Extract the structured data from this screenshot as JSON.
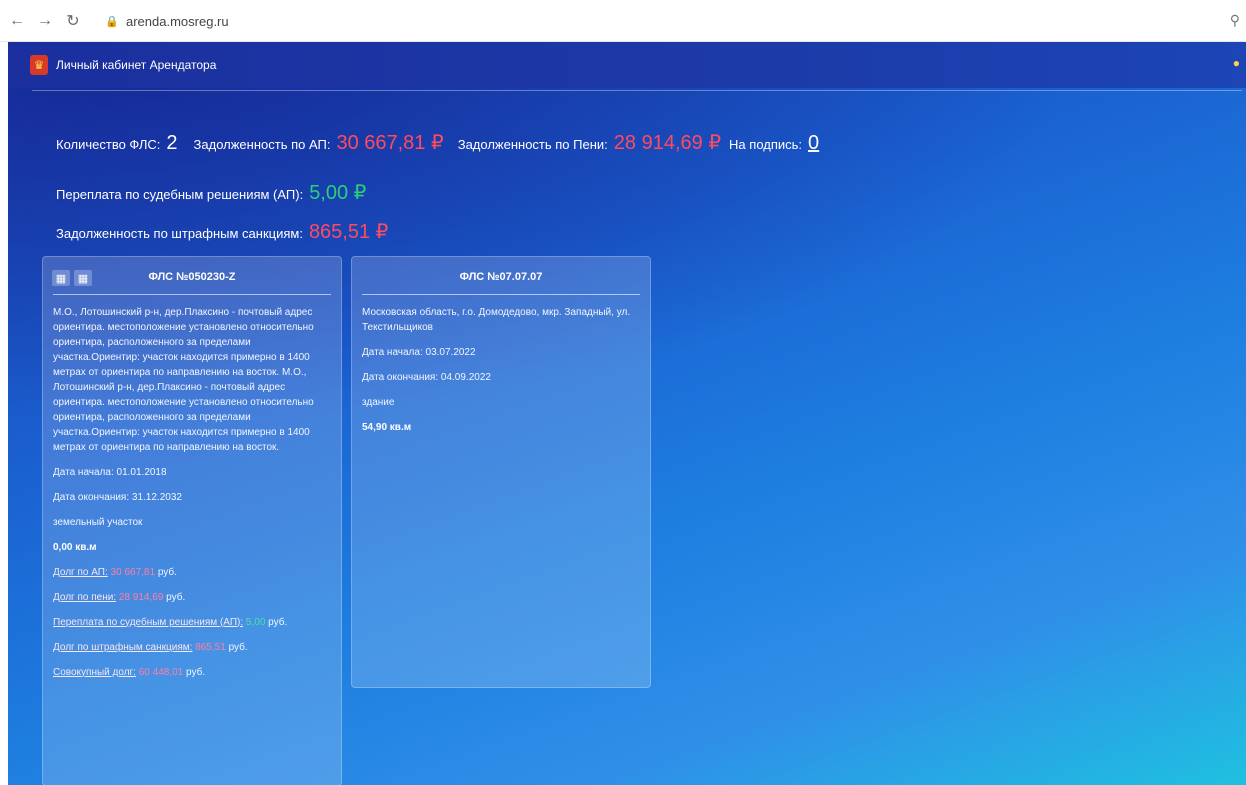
{
  "browser": {
    "back_icon": "arrow-left-icon",
    "forward_icon": "arrow-right-icon",
    "reload_icon": "reload-icon",
    "url": "arenda.mosreg.ru"
  },
  "header": {
    "title": "Личный кабинет Арендатора"
  },
  "summary": {
    "fls_count_label": "Количество ФЛС:",
    "fls_count_value": "2",
    "debt_ap_label": "Задолженность по АП:",
    "debt_ap_value": "30 667,81 ₽",
    "debt_penalty_label": "Задолженность по Пени:",
    "debt_penalty_value": "28 914,69 ₽",
    "to_sign_label": "На подпись:",
    "to_sign_value": "0",
    "overpay_label": "Переплата по судебным решениям (АП):",
    "overpay_value": "5,00 ₽",
    "sanctions_label": "Задолженность по штрафным санкциям:",
    "sanctions_value": "865,51 ₽"
  },
  "cards": [
    {
      "title": "ФЛС №050230-Z",
      "address": "М.О., Лотошинский р-н, дер.Плаксино - почтовый адрес ориентира. местоположение установлено относительно ориентира, расположенного за пределами участка.Ориентир: участок находится примерно в 1400 метрах от ориентира по направлению на восток. М.О., Лотошинский р-н, дер.Плаксино - почтовый адрес ориентира. местоположение установлено относительно ориентира, расположенного за пределами участка.Ориентир: участок находится примерно в 1400 метрах от ориентира по направлению на восток.",
      "start": "Дата начала: 01.01.2018",
      "end": "Дата окончания: 31.12.2032",
      "type": "земельный участок",
      "area": "0,00 кв.м",
      "debt_ap_label": "Долг по АП:",
      "debt_ap_value": "30 667,81",
      "debt_penalty_label": "Долг по пени:",
      "debt_penalty_value": "28 914,69",
      "overpay_label": "Переплата по судебным решениям (АП):",
      "overpay_value": "5,00",
      "sanctions_label": "Долг по штрафным санкциям:",
      "sanctions_value": "865,51",
      "total_label": "Совокупный долг:",
      "total_value": "60 448,01",
      "currency": "руб."
    },
    {
      "title": "ФЛС №07.07.07",
      "address": "Московская область, г.о. Домодедово, мкр. Западный, ул. Текстильщиков",
      "start": "Дата начала: 03.07.2022",
      "end": "Дата окончания: 04.09.2022",
      "type": "здание",
      "area": "54,90 кв.м"
    }
  ],
  "colors": {
    "accent_red": "#ff4a5f",
    "accent_green": "#28d07a",
    "header_blue": "#1b2f9e"
  }
}
